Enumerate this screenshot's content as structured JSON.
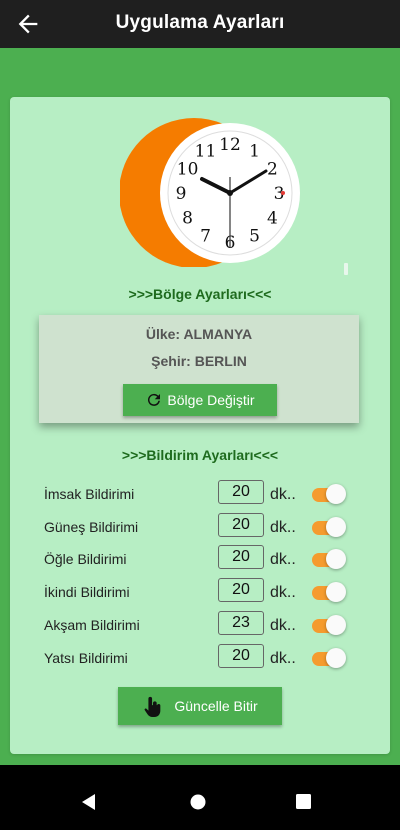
{
  "appbar": {
    "title": "Uygulama Ayarları",
    "back_icon": "arrow-left-icon"
  },
  "clock": {
    "numbers": [
      "12",
      "1",
      "2",
      "3",
      "4",
      "5",
      "6",
      "7",
      "8",
      "9",
      "10",
      "11"
    ],
    "time": "10:08:30",
    "colors": {
      "crescent": "#F57C00",
      "face": "#FFFFFF",
      "second_hand": "#333333",
      "marker": "#E53935"
    }
  },
  "region_section": {
    "title": ">>>Bölge Ayarları<<<",
    "country": "Ülke: ALMANYA",
    "city": "Şehir: BERLIN",
    "change_button": "Bölge Değiştir",
    "change_icon": "refresh-icon"
  },
  "notification_section": {
    "title": ">>>Bildirim Ayarları<<<",
    "unit": "dk..",
    "items": [
      {
        "label": "İmsak Bildirimi",
        "minutes": "20",
        "enabled": true
      },
      {
        "label": "Güneş Bildirimi",
        "minutes": "20",
        "enabled": true
      },
      {
        "label": "Öğle Bildirimi",
        "minutes": "20",
        "enabled": true
      },
      {
        "label": "İkindi Bildirimi",
        "minutes": "20",
        "enabled": true
      },
      {
        "label": "Akşam Bildirimi",
        "minutes": "23",
        "enabled": true
      },
      {
        "label": "Yatsı Bildirimi",
        "minutes": "20",
        "enabled": true
      }
    ]
  },
  "finish_button": {
    "label": "Güncelle Bitir",
    "icon": "tap-hand-icon"
  },
  "colors": {
    "primary": "#4CAF50",
    "card": "#B7EEC4",
    "toggle_on": "#F59B2E",
    "heading": "#1E6B1E"
  },
  "navbar": {
    "icons": [
      "back-triangle-icon",
      "home-circle-icon",
      "recents-square-icon"
    ]
  }
}
